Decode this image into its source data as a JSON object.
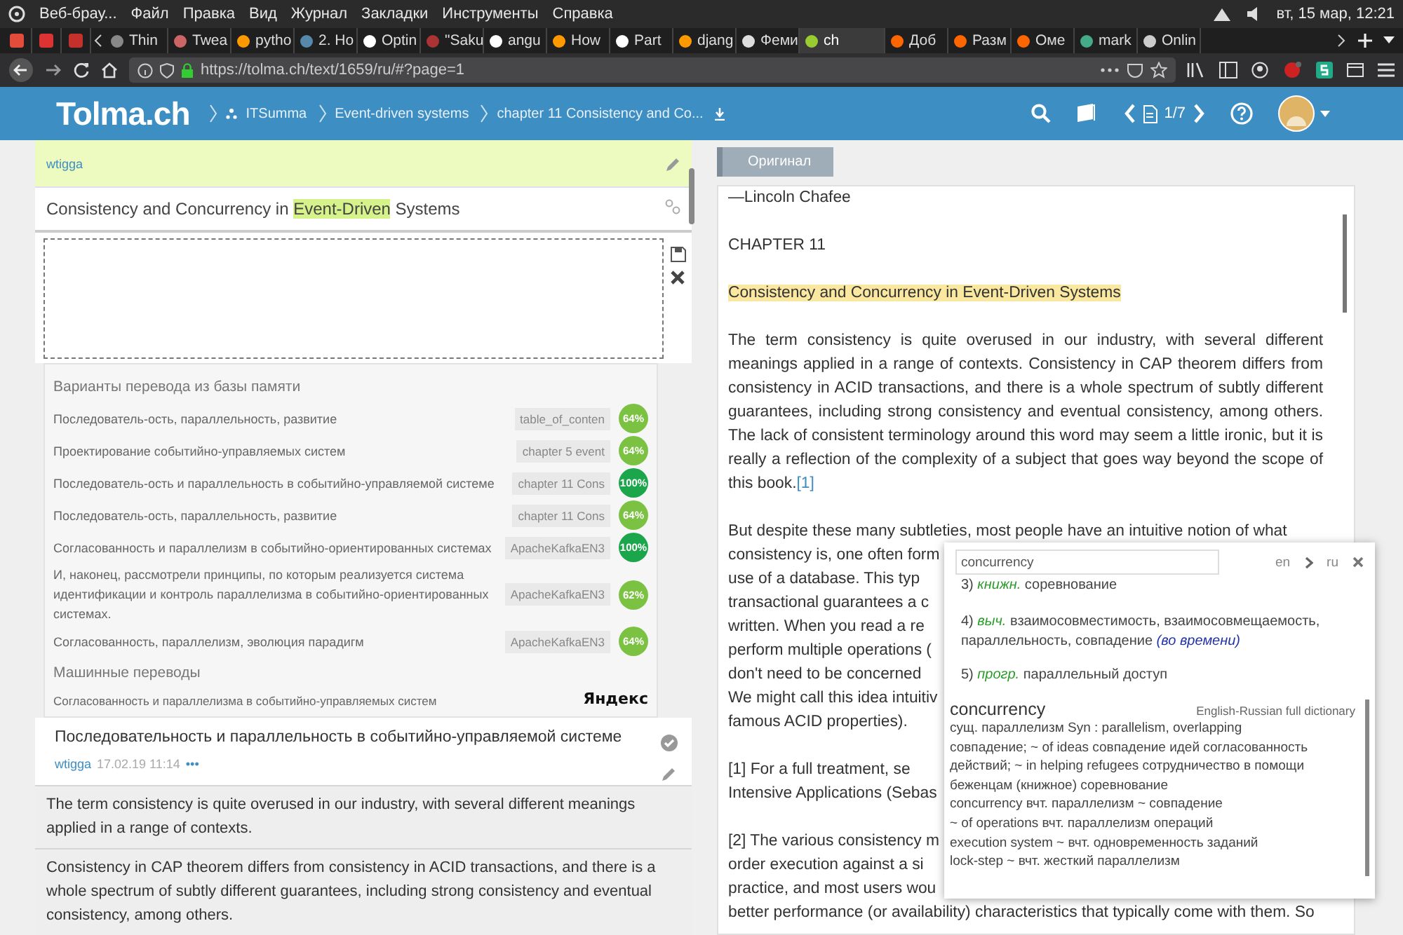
{
  "os_bar": {
    "app": "Веб-брау...",
    "menu": [
      "Файл",
      "Правка",
      "Вид",
      "Журнал",
      "Закладки",
      "Инструменты",
      "Справка"
    ],
    "clock": "вт, 15 мар, 12:21"
  },
  "tabs": [
    {
      "title": "Thin",
      "selected": false
    },
    {
      "title": "Twea",
      "selected": false
    },
    {
      "title": "pytho",
      "selected": false
    },
    {
      "title": "2. Ho",
      "selected": false
    },
    {
      "title": "Optin",
      "selected": false
    },
    {
      "title": "\"Saku",
      "selected": false
    },
    {
      "title": "angu",
      "selected": false
    },
    {
      "title": "How",
      "selected": false
    },
    {
      "title": "Part",
      "selected": false
    },
    {
      "title": "djang",
      "selected": false
    },
    {
      "title": "Феми",
      "selected": false
    },
    {
      "title": "ch",
      "selected": true
    },
    {
      "title": "Доб",
      "selected": false
    },
    {
      "title": "Разм",
      "selected": false
    },
    {
      "title": "Оме",
      "selected": false
    },
    {
      "title": "mark",
      "selected": false
    },
    {
      "title": "Onlin",
      "selected": false
    }
  ],
  "address_bar": {
    "url": "https://tolma.ch/text/1659/ru/#?page=1"
  },
  "header": {
    "logo": "Tolma.ch",
    "breadcrumbs": [
      "ITSumma",
      "Event-driven systems",
      "chapter 11 Consistency and Co..."
    ],
    "page": "1/7"
  },
  "editor": {
    "author_above": "wtigga",
    "source": {
      "before": "Consistency and Concurrency in ",
      "highlight": "Event-Driven",
      "after": " Systems"
    },
    "memory": {
      "title": "Варианты перевода из базы памяти",
      "rows": [
        {
          "text": "Последователь-ость, параллельность, развитие",
          "source": "table_of_conten",
          "score": "64%",
          "color": "#7cc242"
        },
        {
          "text": "Проектирование событийно-управляемых систем",
          "source": "chapter 5 event",
          "score": "64%",
          "color": "#7cc242"
        },
        {
          "text": "Последователь-ость и параллельность в событийно-управляемой системе",
          "source": "chapter 11 Cons",
          "score": "100%",
          "color": "#1ca64c"
        },
        {
          "text": "Последователь-ость, параллельность, развитие",
          "source": "chapter 11 Cons",
          "score": "64%",
          "color": "#7cc242"
        },
        {
          "text": "Согласованность и параллелизм в событийно-ориентированных системах",
          "source": "ApacheKafkaEN3",
          "score": "100%",
          "color": "#1ca64c"
        },
        {
          "text": "И, наконец, рассмотрели принципы, по которым реализуется система идентификации и контроль параллелизма в событийно-ориентированных системах.",
          "source": "ApacheKafkaEN3",
          "score": "62%",
          "color": "#7cc242"
        },
        {
          "text": "Согласованность, параллелизм, эволюция парадигм",
          "source": "ApacheKafkaEN3",
          "score": "64%",
          "color": "#7cc242"
        }
      ],
      "machine_title": "Машинные переводы",
      "machine_text": "Согласованность и параллелизма в событийно-управляемых систем",
      "provider": "Яндекс"
    },
    "translation": {
      "text": "Последовательность и параллельность в событийно-управляемой системе",
      "author": "wtigga",
      "date": "17.02.19 11:14",
      "more": "•••"
    },
    "next_segments": [
      "The term consistency is quite overused in our industry, with several different meanings applied in a range of contexts.",
      "Consistency in CAP theorem differs from consistency in ACID transactions, and there is a whole spectrum of subtly different guarantees, including strong consistency and eventual consistency, among others."
    ]
  },
  "original": {
    "button": "Оригинал",
    "epigraph": "—Lincoln Chafee",
    "chapter": "CHAPTER 11",
    "heading": "Consistency and Concurrency in Event-Driven Systems",
    "heading_highlighted": true,
    "paragraph": "The term consistency is quite overused in our industry, with several different meanings applied in a range of contexts. Consistency in CAP theorem differs from consistency in ACID transactions, and there is a whole spectrum of subtly different guarantees, including strong consistency and eventual consistency, among others. The lack of consistent terminology around this word may seem a little ironic, but it is really a reflection of the complexity of a subject that goes way beyond the scope of this book.",
    "ref": "[1]",
    "lines_top": "But despite these many subtleties, most people have an intuitive notion of what",
    "covered_blocks": [
      [
        "consistency is, one often form",
        "use of a database. This typ",
        "transactional guarantees a c",
        "written. When you read a re",
        "perform multiple operations (",
        "don't need to be concerned",
        "We might call this idea intuitiv",
        "famous ACID properties)."
      ],
      [
        "[1] For a full treatment, se",
        "Intensive Applications (Sebas"
      ],
      [
        "[2] The various consistency m",
        "order execution against a si",
        "practice, and most users wou"
      ]
    ],
    "line_bottom": "better performance (or availability) characteristics that typically come with them. So"
  },
  "dictionary": {
    "query": "concurrency",
    "from": "en",
    "to": "ru",
    "senses": [
      {
        "number": "3)",
        "label": "книжн.",
        "text": "соревнование"
      },
      {
        "number": "4)",
        "label": "выч.",
        "text": "взаимосовместимость, взаимосовмещаемость, параллельность, совпадение",
        "note": "(во времени)"
      },
      {
        "number": "5)",
        "label": "прогр.",
        "text": "параллельный доступ"
      }
    ],
    "word": "concurrency",
    "source": "English-Russian full dictionary",
    "lines": [
      "сущ. параллелизм Syn : parallelism, overlapping",
      "совпадение; ~ of ideas совпадение идей согласованность",
      "действий; ~ in helping refugees сотрудничество в помощи",
      "беженцам (книжное) соревнование",
      "concurrency вчт. параллелизм ~ совпадение",
      "~ of operations вчт. параллелизм операций",
      "execution system ~ вчт. одновременность заданий",
      "lock-step ~ вчт. жесткий параллелизм"
    ]
  }
}
